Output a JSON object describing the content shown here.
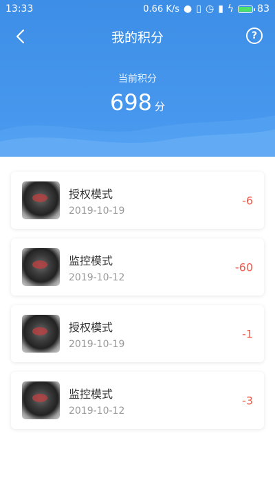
{
  "status_bar": {
    "time": "13:33",
    "network_speed": "0.66 K/s",
    "battery": "83",
    "battery_color": "#4ee06a"
  },
  "nav": {
    "title": "我的积分",
    "help_label": "?"
  },
  "points": {
    "label": "当前积分",
    "value": "698",
    "unit": "分"
  },
  "records": [
    {
      "mode": "授权模式",
      "date": "2019-10-19",
      "delta": "-6"
    },
    {
      "mode": "监控模式",
      "date": "2019-10-12",
      "delta": "-60"
    },
    {
      "mode": "授权模式",
      "date": "2019-10-19",
      "delta": "-1"
    },
    {
      "mode": "监控模式",
      "date": "2019-10-12",
      "delta": "-3"
    }
  ],
  "colors": {
    "header": "#3d8ee6",
    "delta": "#f05a4a"
  }
}
